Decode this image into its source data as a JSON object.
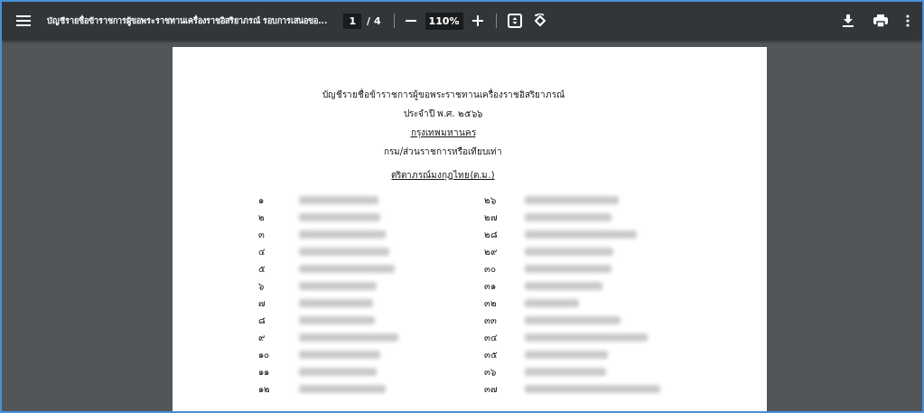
{
  "toolbar": {
    "title": "บัญชีรายชื่อข้าราชการผู้ขอพระราชทานเครื่องราชอิสริยาภรณ์ รอบการเสนอขอ...",
    "page_number": "1",
    "page_total": "/ 4",
    "zoom": "110%"
  },
  "document": {
    "heading": "บัญชีรายชื่อข้าราชการผู้ขอพระราชทานเครื่องราชอิสริยาภรณ์",
    "year": "ประจำปี พ.ศ. ๒๕๖๖",
    "agency": "กรุงเทพมหานคร",
    "department": "กรม/ส่วนราชการหรือเทียบเท่า",
    "decoration": "ตริตาภรณ์มงกุฎไทย(ต.ม.)",
    "rows": [
      {
        "left_number": "๑",
        "right_number": "๒๖"
      },
      {
        "left_number": "๒",
        "right_number": "๒๗"
      },
      {
        "left_number": "๓",
        "right_number": "๒๘"
      },
      {
        "left_number": "๔",
        "right_number": "๒๙"
      },
      {
        "left_number": "๕",
        "right_number": "๓๐"
      },
      {
        "left_number": "๖",
        "right_number": "๓๑"
      },
      {
        "left_number": "๗",
        "right_number": "๓๒"
      },
      {
        "left_number": "๘",
        "right_number": "๓๓"
      },
      {
        "left_number": "๙",
        "right_number": "๓๔"
      },
      {
        "left_number": "๑๐",
        "right_number": "๓๕"
      },
      {
        "left_number": "๑๑",
        "right_number": "๓๖"
      },
      {
        "left_number": "๑๒",
        "right_number": "๓๗"
      }
    ]
  }
}
